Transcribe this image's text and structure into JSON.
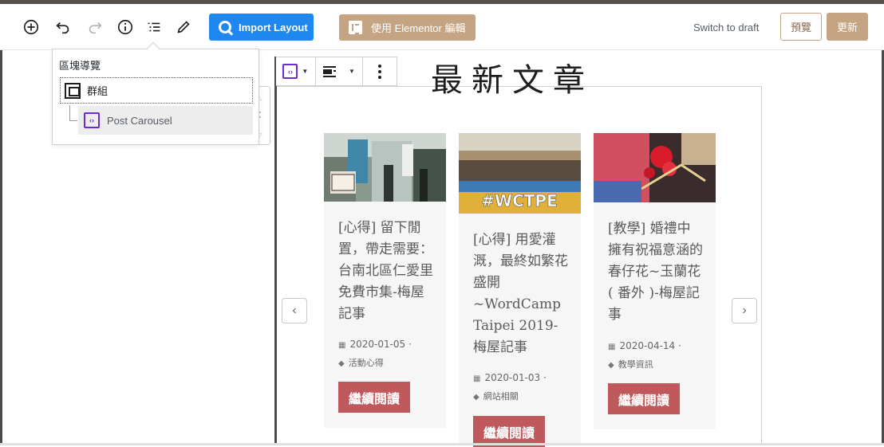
{
  "toolbar": {
    "add_icon": "plus-circle-icon",
    "undo_icon": "undo-icon",
    "redo_icon": "redo-icon",
    "info_icon": "info-icon",
    "list_icon": "list-view-icon",
    "edit_icon": "pencil-icon",
    "import_label": "Import Layout",
    "elementor_label": "使用 Elementor 編輯",
    "switch_draft_label": "Switch to draft",
    "preview_label": "預覽",
    "update_label": "更新"
  },
  "block_nav": {
    "title": "區塊導覽",
    "group_label": "群組",
    "carousel_label": "Post Carousel"
  },
  "editor": {
    "heading": "最新文章"
  },
  "colors": {
    "import_blue": "#1e88f0",
    "elementor_tan": "#c4a482",
    "read_more_red": "#c0595c",
    "carousel_icon_purple": "#6c2bd9"
  },
  "carousel": {
    "prev_icon": "chevron-left-icon",
    "next_icon": "chevron-right-icon",
    "posts": [
      {
        "title": "[心得] 留下閒置，帶走需要：台南北區仁愛里免費市集-梅屋記事",
        "date": "2020-01-05 ·",
        "category": "活動心得",
        "read_more": "繼續閱讀"
      },
      {
        "title": "[心得] 用愛灌溉，最終如繁花盛開 ~WordCamp Taipei 2019-梅屋記事",
        "date": "2020-01-03 ·",
        "category": "網站相關",
        "read_more": "繼續閱讀",
        "image_text": "#WCTPE"
      },
      {
        "title": "[教學] 婚禮中擁有祝福意涵的春仔花~玉蘭花( 番外 )-梅屋記事",
        "date": "2020-04-14 ·",
        "category": "教學資訊",
        "read_more": "繼續閱讀"
      }
    ]
  }
}
